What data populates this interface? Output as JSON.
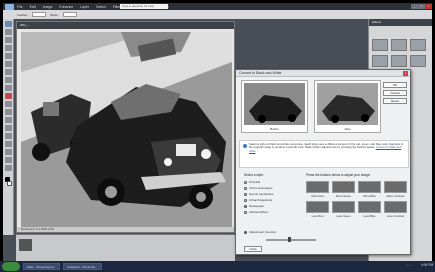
{
  "app": {
    "menu": [
      "File",
      "Edit",
      "Image",
      "Enhance",
      "Layer",
      "Select",
      "Filter",
      "View",
      "Window",
      "Help"
    ],
    "help_placeholder": "Type a question for help",
    "window_buttons": [
      "_",
      "□",
      "×"
    ]
  },
  "options_bar": {
    "label1": "Feather:",
    "label2": "Mode:"
  },
  "document": {
    "title": "IMG_...",
    "status": "Document: 6.17M/6.17M"
  },
  "right_panel": {
    "title": "Effects"
  },
  "dialog": {
    "title": "Convert to Black and White",
    "close": "×",
    "before_label": "Before",
    "after_label": "After",
    "buttons": [
      "OK",
      "Cancel",
      "Reset"
    ],
    "tip_text": "Select a style of black and white conversion. Each style uses a different amount of the red, green, and blue color channels of the original image to produce a specific look. Make further adjustments by pressing the buttons below.",
    "tip_link": "Convert to black and white",
    "style_label": "Select a style:",
    "styles": [
      "Portraits",
      "Vivid Landscapes",
      "Scenic Landscape",
      "Urban/Snapshots",
      "Newspaper",
      "Infrared Effect"
    ],
    "intensity_label": "Adjustment Intensity:",
    "adjust_label": "Press the buttons below to adjust your image:",
    "controls_top": [
      "More Red",
      "More Green",
      "More Blue",
      "More Contrast"
    ],
    "controls_bottom": [
      "Less Red",
      "Less Green",
      "Less Blue",
      "Less Contrast"
    ],
    "undo_label": "Undo"
  },
  "taskbar": {
    "tasks": [
      "Effec - Photoshop E...",
      "Snapshot - Photosho..."
    ],
    "clock": "4:06 PM"
  }
}
